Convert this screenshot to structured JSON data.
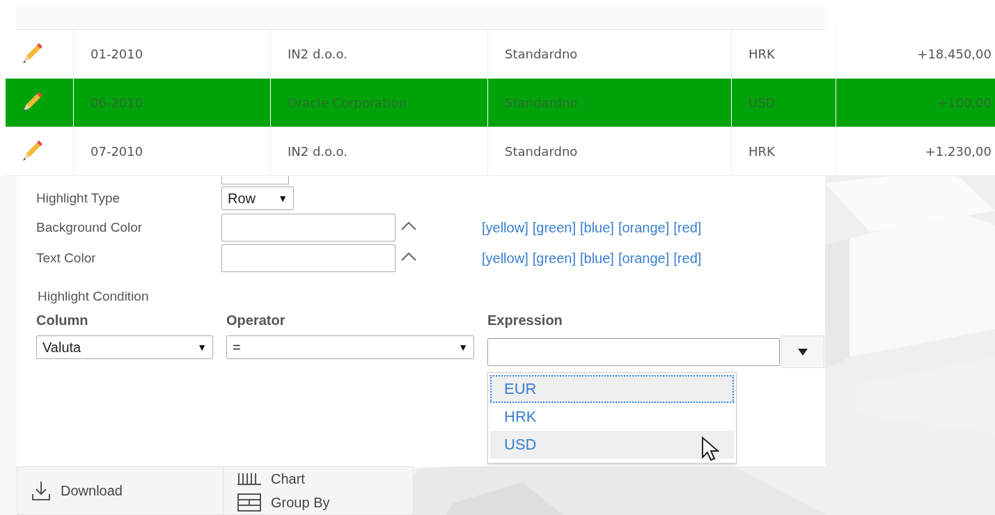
{
  "table": {
    "rows": [
      {
        "period": "01-2010",
        "company": "IN2 d.o.o.",
        "type": "Standardno",
        "currency": "HRK",
        "amount": "+18.450,00",
        "highlighted": false
      },
      {
        "period": "06-2010",
        "company": "Oracle Corporation",
        "type": "Standardno",
        "currency": "USD",
        "amount": "+100,00",
        "highlighted": true
      },
      {
        "period": "07-2010",
        "company": "IN2 d.o.o.",
        "type": "Standardno",
        "currency": "HRK",
        "amount": "+1.230,00",
        "highlighted": false
      }
    ]
  },
  "form": {
    "highlight_type": {
      "label": "Highlight Type",
      "value": "Row",
      "arrow": "▼"
    },
    "color_fields": [
      {
        "label": "Background Color",
        "links": [
          "[yellow]",
          "[green]",
          "[blue]",
          "[orange]",
          "[red]"
        ]
      },
      {
        "label": "Text Color",
        "links": [
          "[yellow]",
          "[green]",
          "[blue]",
          "[orange]",
          "[red]"
        ]
      }
    ],
    "condition": {
      "title": "Highlight Condition",
      "column": {
        "label": "Column",
        "value": "Valuta",
        "arrow": "▼"
      },
      "operator": {
        "label": "Operator",
        "value": "=",
        "arrow": "▼"
      },
      "expression": {
        "label": "Expression",
        "options": [
          {
            "label": "EUR",
            "focused": true,
            "hovered": false
          },
          {
            "label": "HRK",
            "focused": false,
            "hovered": false
          },
          {
            "label": "USD",
            "focused": false,
            "hovered": true
          }
        ]
      }
    }
  },
  "menu": {
    "items": [
      {
        "kind": "download",
        "label": "Download"
      },
      {
        "kind": "chart",
        "label": "Chart"
      },
      {
        "kind": "group",
        "label": "Group By"
      }
    ]
  }
}
